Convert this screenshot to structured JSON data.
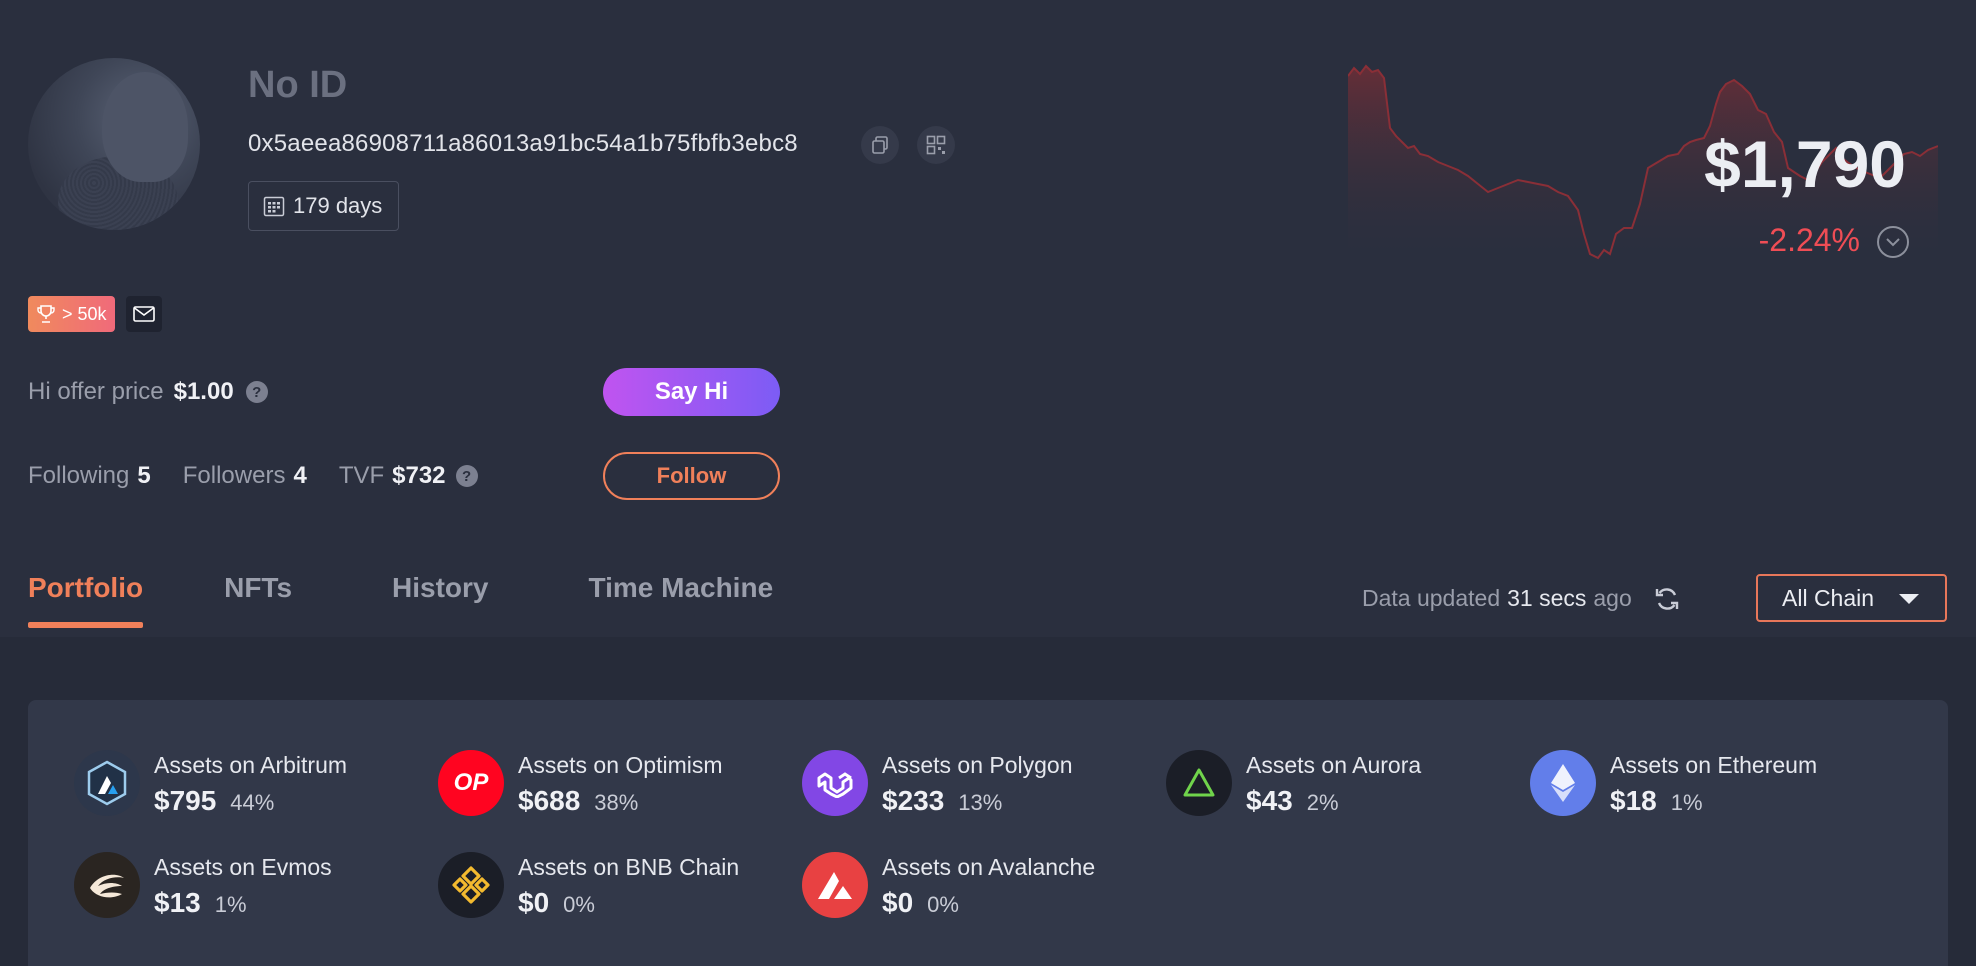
{
  "profile": {
    "title": "No ID",
    "address": "0x5aeea86908711a86013a91bc54a1b75fbfb3ebc8",
    "days": "179 days",
    "badge": "> 50k"
  },
  "offer": {
    "label": "Hi offer price",
    "value": "$1.00",
    "button": "Say Hi"
  },
  "social": {
    "following_label": "Following",
    "following": "5",
    "followers_label": "Followers",
    "followers": "4",
    "tvf_label": "TVF",
    "tvf": "$732",
    "follow_button": "Follow"
  },
  "net_worth": {
    "value": "$1,790",
    "change": "-2.24%"
  },
  "tabs": [
    {
      "label": "Portfolio",
      "active": true
    },
    {
      "label": "NFTs",
      "active": false
    },
    {
      "label": "History",
      "active": false
    },
    {
      "label": "Time Machine",
      "active": false
    }
  ],
  "updated": {
    "prefix": "Data updated",
    "time": "31 secs",
    "suffix": "ago"
  },
  "chain_select": {
    "value": "All Chain"
  },
  "assets": [
    {
      "name": "Assets on Arbitrum",
      "value": "$795",
      "pct": "44%",
      "icon": "arbitrum-icon",
      "color": "#2d374b"
    },
    {
      "name": "Assets on Optimism",
      "value": "$688",
      "pct": "38%",
      "icon": "optimism-icon",
      "color": "#ff0420"
    },
    {
      "name": "Assets on Polygon",
      "value": "$233",
      "pct": "13%",
      "icon": "polygon-icon",
      "color": "#8247e5"
    },
    {
      "name": "Assets on Aurora",
      "value": "$43",
      "pct": "2%",
      "icon": "aurora-icon",
      "color": "#1b1e27"
    },
    {
      "name": "Assets on Ethereum",
      "value": "$18",
      "pct": "1%",
      "icon": "ethereum-icon",
      "color": "#627eea"
    },
    {
      "name": "Assets on Evmos",
      "value": "$13",
      "pct": "1%",
      "icon": "evmos-icon",
      "color": "#2a2521"
    },
    {
      "name": "Assets on BNB Chain",
      "value": "$0",
      "pct": "0%",
      "icon": "bnb-icon",
      "color": "#1b1e27"
    },
    {
      "name": "Assets on Avalanche",
      "value": "$0",
      "pct": "0%",
      "icon": "avalanche-icon",
      "color": "#e84142"
    }
  ],
  "colors": {
    "accent": "#f0805a",
    "negative": "#ef4d55",
    "background": "#2a2f3e"
  }
}
